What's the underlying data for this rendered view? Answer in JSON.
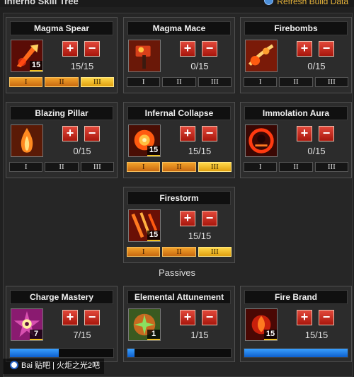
{
  "header": {
    "title": "Inferno Skill Tree",
    "refresh_label": "Refresh Build Data"
  },
  "skills": [
    {
      "name": "Magma Spear",
      "points": "15/15",
      "rank": "15",
      "icon": "magma-spear-icon",
      "tiers": [
        "I",
        "II",
        "III"
      ],
      "tiers_unlocked": 3
    },
    {
      "name": "Magma Mace",
      "points": "0/15",
      "rank": "",
      "icon": "magma-mace-icon",
      "tiers": [
        "I",
        "II",
        "III"
      ],
      "tiers_unlocked": 0
    },
    {
      "name": "Firebombs",
      "points": "0/15",
      "rank": "",
      "icon": "firebombs-icon",
      "tiers": [
        "I",
        "II",
        "III"
      ],
      "tiers_unlocked": 0
    },
    {
      "name": "Blazing Pillar",
      "points": "0/15",
      "rank": "",
      "icon": "blazing-pillar-icon",
      "tiers": [
        "I",
        "II",
        "III"
      ],
      "tiers_unlocked": 0
    },
    {
      "name": "Infernal Collapse",
      "points": "15/15",
      "rank": "15",
      "icon": "infernal-collapse-icon",
      "tiers": [
        "I",
        "II",
        "III"
      ],
      "tiers_unlocked": 3
    },
    {
      "name": "Immolation Aura",
      "points": "0/15",
      "rank": "",
      "icon": "immolation-aura-icon",
      "tiers": [
        "I",
        "II",
        "III"
      ],
      "tiers_unlocked": 0
    },
    {
      "name": "Firestorm",
      "points": "15/15",
      "rank": "15",
      "icon": "firestorm-icon",
      "tiers": [
        "I",
        "II",
        "III"
      ],
      "tiers_unlocked": 3
    }
  ],
  "passives_label": "Passives",
  "passives": [
    {
      "name": "Charge Mastery",
      "points": "7/15",
      "rank": "7",
      "icon": "charge-mastery-icon",
      "progress": 0.47
    },
    {
      "name": "Elemental Attunement",
      "points": "1/15",
      "rank": "1",
      "icon": "elemental-attunement-icon",
      "progress": 0.07
    },
    {
      "name": "Fire Brand",
      "points": "15/15",
      "rank": "15",
      "icon": "fire-brand-icon",
      "progress": 1.0
    }
  ],
  "buttons": {
    "plus": "+",
    "minus": "−"
  },
  "watermark": {
    "text": "Bai 贴吧 | 火炬之光2吧"
  },
  "colors": {
    "accent_orange": "#f3a22a",
    "accent_gold": "#ffd84a",
    "progress_blue": "#2f8cf0",
    "button_red": "#c8281a",
    "refresh_gold": "#e8b53a"
  }
}
